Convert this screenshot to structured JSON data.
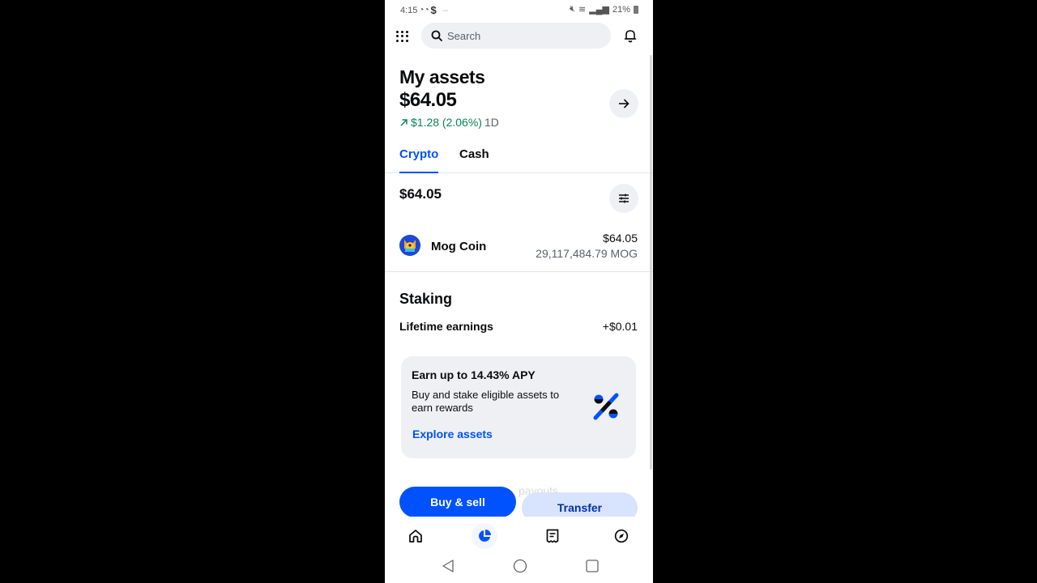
{
  "status_bar": {
    "time": "4:15",
    "battery": "21%"
  },
  "search": {
    "placeholder": "Search"
  },
  "header": {
    "title": "My assets",
    "total_balance": "$64.05",
    "change_amount": "$1.28 (2.06%)",
    "change_period": "1D",
    "change_color": "#098551"
  },
  "tabs": [
    {
      "label": "Crypto",
      "active": true
    },
    {
      "label": "Cash",
      "active": false
    }
  ],
  "crypto": {
    "total": "$64.05",
    "assets": [
      {
        "name": "Mog Coin",
        "value": "$64.05",
        "amount": "29,117,484.79 MOG"
      }
    ]
  },
  "staking": {
    "title": "Staking",
    "lifetime_label": "Lifetime earnings",
    "lifetime_value": "+$0.01",
    "promo": {
      "title": "Earn up to 14.43% APY",
      "body": "Buy and stake eligible assets to earn rewards",
      "link": "Explore assets"
    }
  },
  "hidden_section_text": "payouts",
  "actions": {
    "buy_sell": "Buy & sell",
    "transfer": "Transfer"
  },
  "bottom_nav": [
    {
      "name": "home",
      "icon": "home-icon",
      "active": false
    },
    {
      "name": "assets",
      "icon": "pie-chart-icon",
      "active": true
    },
    {
      "name": "transactions",
      "icon": "receipt-icon",
      "active": false
    },
    {
      "name": "explore",
      "icon": "compass-icon",
      "active": false
    }
  ],
  "colors": {
    "brand": "#0052ff",
    "positive": "#098551"
  }
}
